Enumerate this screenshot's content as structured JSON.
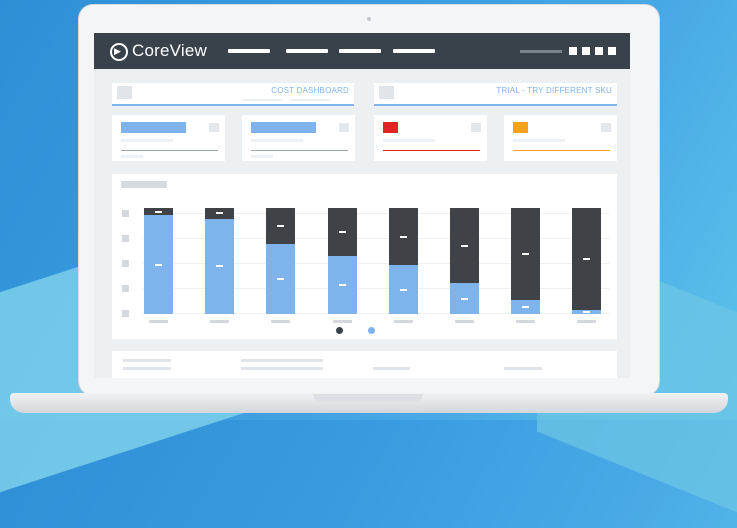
{
  "brand": {
    "name": "CoreView",
    "logo_icon": "play-circle-icon"
  },
  "nav": {
    "link_count": 4,
    "user_blocks": 4
  },
  "panels": {
    "left_title": "COST DASHBOARD",
    "right_title": "TRIAL - TRY DIFFERENT SKU"
  },
  "cards": [
    {
      "accent": "#7fb3ec"
    },
    {
      "accent": "#7fb3ec"
    },
    {
      "accent": "#e02424"
    },
    {
      "accent": "#f4a21e"
    }
  ],
  "colors": {
    "nav_bg": "#39414a",
    "dark_series": "#3f4247",
    "blue_series": "#7fb3ec",
    "header_accent": "#7fb3ec"
  },
  "chart_data": {
    "type": "bar",
    "stacked": true,
    "categories": [
      "",
      "",
      "",
      "",
      "",
      "",
      "",
      ""
    ],
    "series": [
      {
        "values": [
          93,
          90,
          66,
          55,
          46,
          29,
          13,
          4
        ]
      },
      {
        "values": [
          7,
          10,
          34,
          45,
          54,
          71,
          87,
          96
        ]
      }
    ],
    "ylim": [
      0,
      100
    ],
    "grid": true,
    "legend": "bottom-center"
  }
}
